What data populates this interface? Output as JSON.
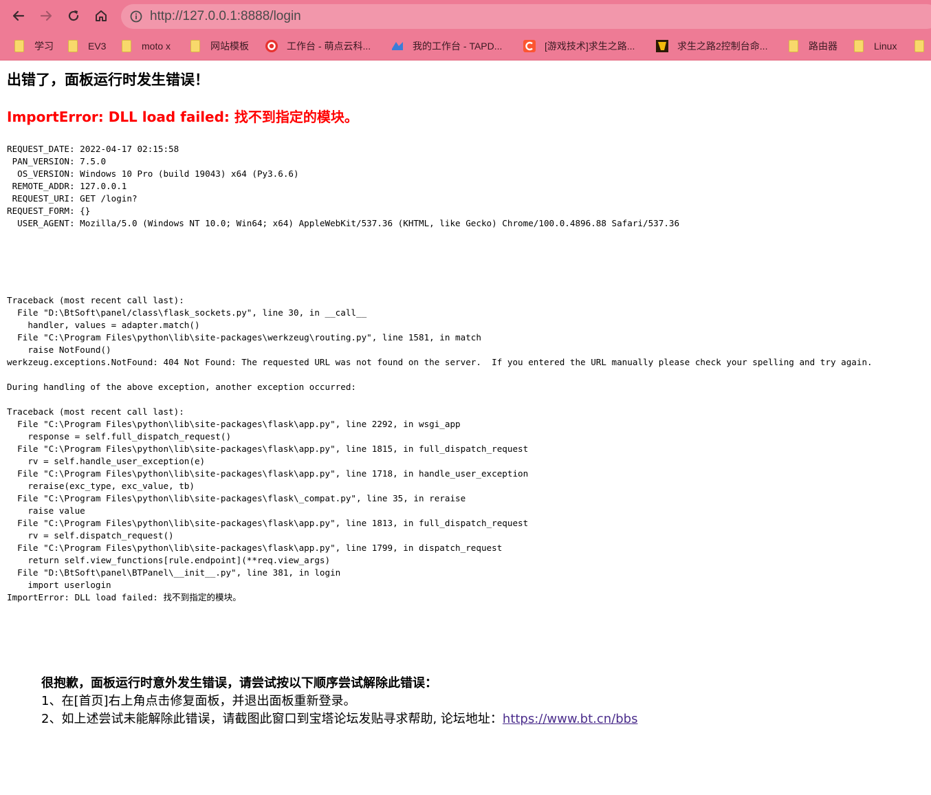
{
  "browser": {
    "url": "http://127.0.0.1:8888/login",
    "bookmarks": [
      {
        "label": "学习",
        "icon": "folder-icon"
      },
      {
        "label": "EV3",
        "icon": "folder-icon"
      },
      {
        "label": "moto x",
        "icon": "folder-icon"
      },
      {
        "label": "网站模板",
        "icon": "folder-icon"
      },
      {
        "label": "工作台 - 萌点云科...",
        "icon": "red-circle-logo-icon"
      },
      {
        "label": "我的工作台 - TAPD...",
        "icon": "tapd-logo-icon"
      },
      {
        "label": "[游戏技术]求生之路...",
        "icon": "csdn-logo-icon"
      },
      {
        "label": "求生之路2控制台命...",
        "icon": "game-logo-icon"
      },
      {
        "label": "路由器",
        "icon": "folder-icon"
      },
      {
        "label": "Linux",
        "icon": "folder-icon"
      }
    ]
  },
  "page": {
    "title": "出错了，面板运行时发生错误！",
    "error": "ImportError: DLL load failed: 找不到指定的模块。",
    "request_info": "REQUEST_DATE: 2022-04-17 02:15:58\n PAN_VERSION: 7.5.0\n  OS_VERSION: Windows 10 Pro (build 19043) x64 (Py3.6.6)\n REMOTE_ADDR: 127.0.0.1\n REQUEST_URI: GET /login?\nREQUEST_FORM: {}\n  USER_AGENT: Mozilla/5.0 (Windows NT 10.0; Win64; x64) AppleWebKit/537.36 (KHTML, like Gecko) Chrome/100.0.4896.88 Safari/537.36",
    "traceback": "Traceback (most recent call last):\n  File \"D:\\BtSoft\\panel/class\\flask_sockets.py\", line 30, in __call__\n    handler, values = adapter.match()\n  File \"C:\\Program Files\\python\\lib\\site-packages\\werkzeug\\routing.py\", line 1581, in match\n    raise NotFound()\nwerkzeug.exceptions.NotFound: 404 Not Found: The requested URL was not found on the server.  If you entered the URL manually please check your spelling and try again.\n\nDuring handling of the above exception, another exception occurred:\n\nTraceback (most recent call last):\n  File \"C:\\Program Files\\python\\lib\\site-packages\\flask\\app.py\", line 2292, in wsgi_app\n    response = self.full_dispatch_request()\n  File \"C:\\Program Files\\python\\lib\\site-packages\\flask\\app.py\", line 1815, in full_dispatch_request\n    rv = self.handle_user_exception(e)\n  File \"C:\\Program Files\\python\\lib\\site-packages\\flask\\app.py\", line 1718, in handle_user_exception\n    reraise(exc_type, exc_value, tb)\n  File \"C:\\Program Files\\python\\lib\\site-packages\\flask\\_compat.py\", line 35, in reraise\n    raise value\n  File \"C:\\Program Files\\python\\lib\\site-packages\\flask\\app.py\", line 1813, in full_dispatch_request\n    rv = self.dispatch_request()\n  File \"C:\\Program Files\\python\\lib\\site-packages\\flask\\app.py\", line 1799, in dispatch_request\n    return self.view_functions[rule.endpoint](**req.view_args)\n  File \"D:\\BtSoft\\panel\\BTPanel\\__init__.py\", line 381, in login\n    import userlogin\nImportError: DLL load failed: 找不到指定的模块。",
    "help": {
      "heading": "很抱歉，面板运行时意外发生错误，请尝试按以下顺序尝试解除此错误：",
      "step1": "1、在[首页]右上角点击修复面板，并退出面板重新登录。",
      "step2_prefix": "2、如上述尝试未能解除此错误，请截图此窗口到宝塔论坛发贴寻求帮助, 论坛地址：",
      "forum_link": "https://www.bt.cn/bbs"
    }
  }
}
